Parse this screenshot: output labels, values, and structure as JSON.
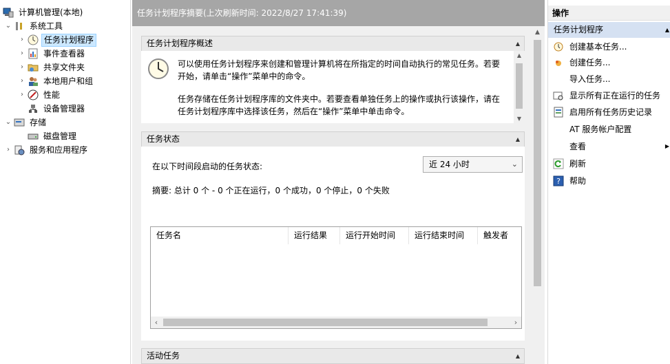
{
  "tree": {
    "root": "计算机管理(本地)",
    "system_tools": "系统工具",
    "task_scheduler": "任务计划程序",
    "event_viewer": "事件查看器",
    "shared_folders": "共享文件夹",
    "local_users": "本地用户和组",
    "performance": "性能",
    "device_manager": "设备管理器",
    "storage": "存储",
    "disk_management": "磁盘管理",
    "services_apps": "服务和应用程序"
  },
  "center": {
    "header": "任务计划程序摘要(上次刷新时间: 2022/8/27 17:41:39)",
    "overview": {
      "title": "任务计划程序概述",
      "para1_line1": "可以使用任务计划程序来创建和管理计算机将在所指定的时间自动执行的常见任务。若要",
      "para1_line2": "开始，请单击“操作”菜单中的命令。",
      "para2_line1": "任务存储在任务计划程序库的文件夹中。若要查看单独任务上的操作或执行该操作，请在",
      "para2_line2": "任务计划程序库中选择该任务，然后在“操作”菜单中单击命令。"
    },
    "status": {
      "title": "任务状态",
      "period_label": "在以下时间段启动的任务状态:",
      "period_value": "近 24 小时",
      "summary": "摘要: 总计 0 个 - 0 个正在运行，0 个成功，0 个停止，0 个失败",
      "columns": [
        "任务名",
        "运行结果",
        "运行开始时间",
        "运行结束时间",
        "触发者"
      ]
    },
    "active": {
      "title": "活动任务"
    }
  },
  "actions": {
    "title": "操作",
    "group": "任务计划程序",
    "items": [
      {
        "label": "创建基本任务...",
        "icon": "wizard-clock-icon"
      },
      {
        "label": "创建任务...",
        "icon": "task-icon"
      },
      {
        "label": "导入任务...",
        "icon": ""
      },
      {
        "label": "显示所有正在运行的任务",
        "icon": "running-tasks-icon"
      },
      {
        "label": "启用所有任务历史记录",
        "icon": "history-icon"
      },
      {
        "label": "AT 服务帐户配置",
        "icon": ""
      },
      {
        "label": "查看",
        "icon": ""
      },
      {
        "label": "刷新",
        "icon": "refresh-icon"
      },
      {
        "label": "帮助",
        "icon": "help-icon"
      }
    ]
  },
  "colors": {
    "header_bg": "#a6a6a6",
    "selected_bg": "#cce8ff",
    "action_group_bg": "#d5e1f2",
    "section_head_bg": "#e9e9e9"
  }
}
